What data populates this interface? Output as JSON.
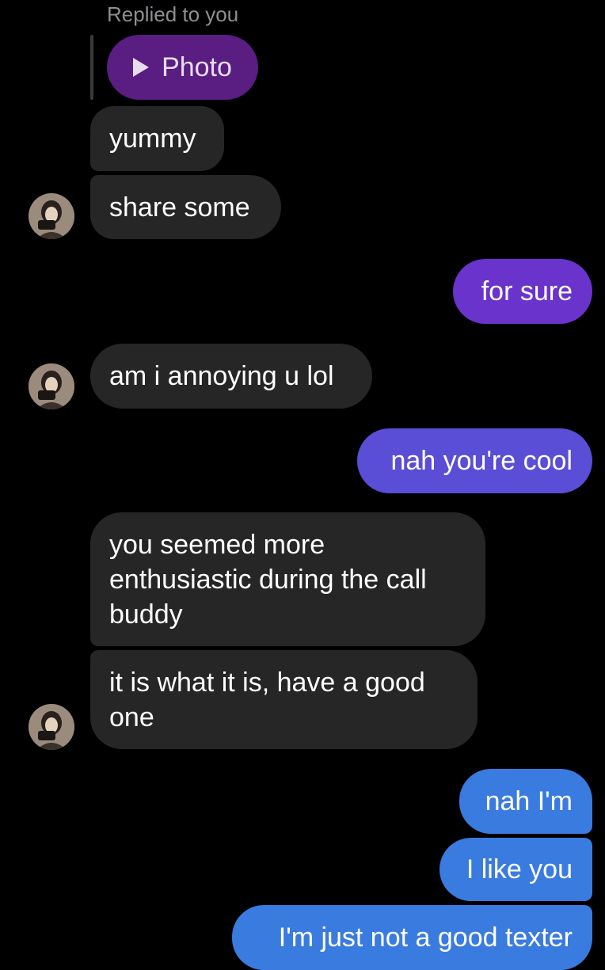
{
  "reply_context": {
    "label": "Replied to you",
    "attachment_label": "Photo"
  },
  "messages": [
    {
      "sender": "them",
      "text": "yummy"
    },
    {
      "sender": "them",
      "text": "share some"
    },
    {
      "sender": "me",
      "text": "for sure"
    },
    {
      "sender": "them",
      "text": "am i annoying u lol"
    },
    {
      "sender": "me",
      "text": "nah you're cool"
    },
    {
      "sender": "them",
      "text": "you seemed more enthusiastic during the call buddy"
    },
    {
      "sender": "them",
      "text": "it is what it is, have a good one"
    },
    {
      "sender": "me",
      "text": "nah I'm"
    },
    {
      "sender": "me",
      "text": "I like you"
    },
    {
      "sender": "me",
      "text": "I'm just not a good texter"
    }
  ],
  "colors": {
    "background": "#000000",
    "incoming_bubble": "#262626",
    "reply_photo": "#5a1d82",
    "outgoing_purple": "#6a33cc",
    "outgoing_indigo": "#5a4ed6",
    "outgoing_blue": "#3a7be0"
  },
  "icons": {
    "play": "play-icon",
    "avatar": "avatar"
  }
}
